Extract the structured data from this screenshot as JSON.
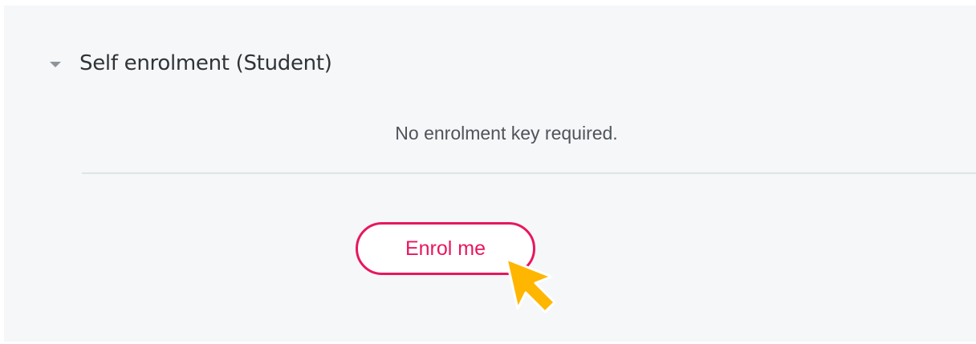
{
  "enrolment": {
    "title": "Self enrolment (Student)",
    "toggle_icon": "collapse-triangle-icon",
    "note": "No enrolment key required.",
    "button_label": "Enrol me"
  },
  "colors": {
    "panel_background": "#f5f7f9",
    "accent": "#e8175d",
    "cursor": "#ffb600"
  },
  "cursor_icon": "pointer-arrow-icon"
}
